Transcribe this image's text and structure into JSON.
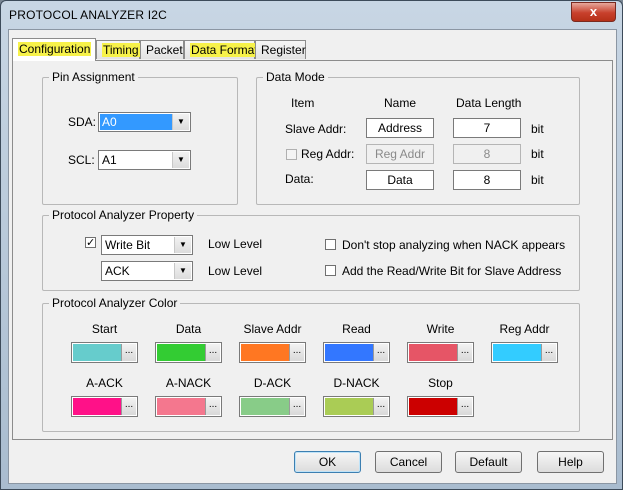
{
  "window": {
    "title": "PROTOCOL ANALYZER I2C",
    "close_label": "x"
  },
  "tabs": [
    {
      "label": "Configuration"
    },
    {
      "label": "Timing"
    },
    {
      "label": "Packet"
    },
    {
      "label": "Data Format"
    },
    {
      "label": "Register"
    }
  ],
  "pin_assignment": {
    "title": "Pin Assignment",
    "sda_label": "SDA:",
    "sda_value": "A0",
    "scl_label": "SCL:",
    "scl_value": "A1"
  },
  "data_mode": {
    "title": "Data Mode",
    "col_item": "Item",
    "col_name": "Name",
    "col_length": "Data Length",
    "slave_label": "Slave Addr:",
    "slave_name": "Address",
    "slave_len": "7",
    "slave_unit": "bit",
    "reg_label": "Reg Addr:",
    "reg_name": "Reg Addr",
    "reg_len": "8",
    "reg_unit": "bit",
    "data_label": "Data:",
    "data_name": "Data",
    "data_len": "8",
    "data_unit": "bit"
  },
  "property": {
    "title": "Protocol Analyzer Property",
    "combo1_value": "Write Bit",
    "combo1_level": "Low Level",
    "combo2_value": "ACK",
    "combo2_level": "Low Level",
    "opt1_label": "Don't stop analyzing  when NACK appears",
    "opt2_label": "Add the Read/Write Bit for Slave Address",
    "check_mark": "✓"
  },
  "colors": {
    "title": "Protocol Analyzer Color",
    "dots": "...",
    "items": [
      {
        "label": "Start",
        "color": "#66cccc"
      },
      {
        "label": "Data",
        "color": "#33cc33"
      },
      {
        "label": "Slave Addr",
        "color": "#ff7722"
      },
      {
        "label": "Read",
        "color": "#3377ff"
      },
      {
        "label": "Write",
        "color": "#e65566"
      },
      {
        "label": "Reg Addr",
        "color": "#33ccff"
      },
      {
        "label": "A-ACK",
        "color": "#ff1188"
      },
      {
        "label": "A-NACK",
        "color": "#f4778e"
      },
      {
        "label": "D-ACK",
        "color": "#88cc88"
      },
      {
        "label": "D-NACK",
        "color": "#aacc55"
      },
      {
        "label": "Stop",
        "color": "#cc0000"
      }
    ]
  },
  "buttons": {
    "ok": "OK",
    "cancel": "Cancel",
    "default": "Default",
    "help": "Help"
  }
}
